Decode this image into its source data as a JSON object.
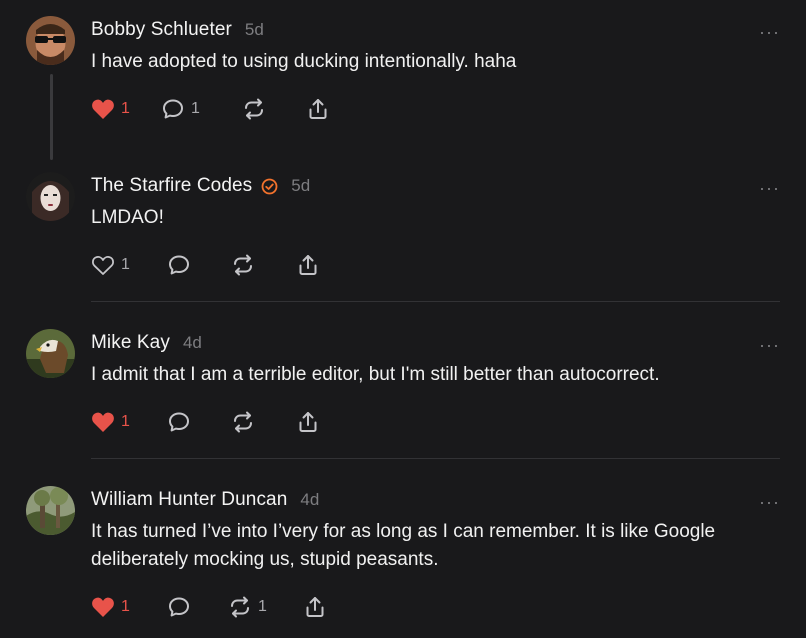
{
  "comments": [
    {
      "name": "Bobby Schlueter",
      "time": "5d",
      "verified": false,
      "text": "I have adopted to using ducking intentionally. haha",
      "more": "···",
      "likes": "1",
      "liked": true,
      "replies": "1",
      "restacks": ""
    },
    {
      "name": "The Starfire Codes",
      "time": "5d",
      "verified": true,
      "text": "LMDAO!",
      "more": "···",
      "likes": "1",
      "liked": false,
      "replies": "",
      "restacks": ""
    },
    {
      "name": "Mike Kay",
      "time": "4d",
      "verified": false,
      "text": "I admit that I am a terrible editor, but I'm still better than autocorrect.",
      "more": "···",
      "likes": "1",
      "liked": true,
      "replies": "",
      "restacks": ""
    },
    {
      "name": "William Hunter Duncan",
      "time": "4d",
      "verified": false,
      "text": "It has turned I’ve into I’very for as long as I can remember. It is like Google deliberately mocking us, stupid peasants.",
      "more": "···",
      "likes": "1",
      "liked": true,
      "replies": "",
      "restacks": "1"
    }
  ],
  "colors": {
    "background": "#19191b",
    "like": "#e8534a",
    "verified": "#f3722c",
    "muted": "#7d7d80"
  },
  "icons": [
    "heart-icon",
    "comment-bubble-icon",
    "restack-icon",
    "share-icon",
    "verified-check-icon",
    "more-dots-icon"
  ]
}
